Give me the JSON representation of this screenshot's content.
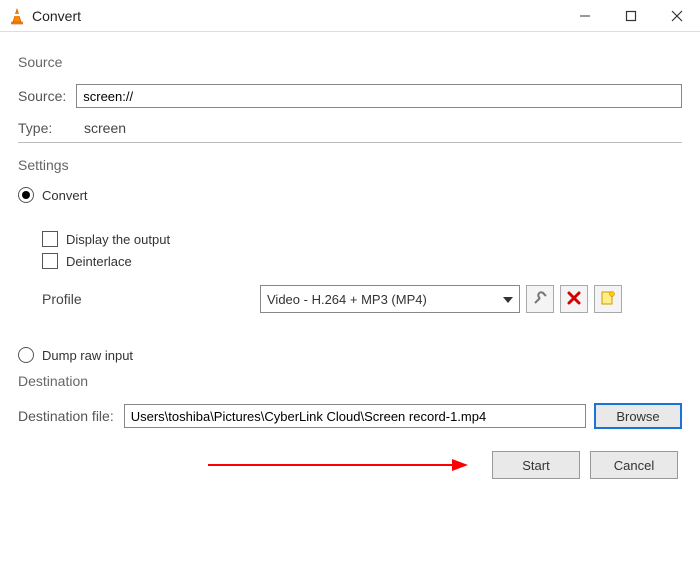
{
  "window": {
    "title": "Convert"
  },
  "source": {
    "section_label": "Source",
    "source_label": "Source:",
    "source_value": "screen://",
    "type_label": "Type:",
    "type_value": "screen"
  },
  "settings": {
    "section_label": "Settings",
    "convert_label": "Convert",
    "display_output_label": "Display the output",
    "deinterlace_label": "Deinterlace",
    "profile_label": "Profile",
    "profile_selected": "Video - H.264 + MP3 (MP4)",
    "dump_raw_label": "Dump raw input"
  },
  "destination": {
    "section_label": "Destination",
    "file_label": "Destination file:",
    "file_value": "Users\\toshiba\\Pictures\\CyberLink Cloud\\Screen record-1.mp4",
    "browse_label": "Browse"
  },
  "buttons": {
    "start": "Start",
    "cancel": "Cancel"
  }
}
